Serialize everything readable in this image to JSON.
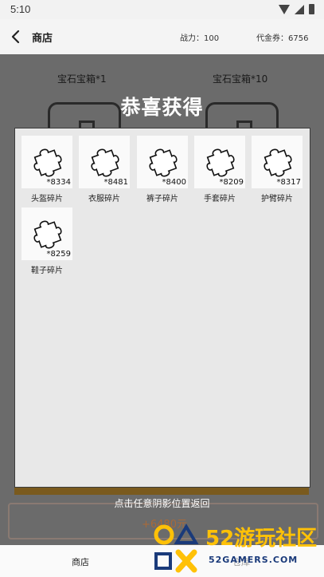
{
  "status_bar": {
    "time": "5:10",
    "icons": [
      "wifi-icon",
      "signal-icon",
      "battery-icon"
    ]
  },
  "header": {
    "back_icon": "chevron-left-icon",
    "title": "商店",
    "power_label": "战力：100",
    "coupon_label": "代金券：6756"
  },
  "shop_background": {
    "chest_labels": [
      "宝石宝箱*1",
      "宝石宝箱*10"
    ],
    "buy_button_text": "+6480元"
  },
  "reward_dialog": {
    "title": "恭喜获得",
    "items": [
      {
        "name": "头盔碎片",
        "count": "*8334",
        "icon": "puzzle-piece-icon"
      },
      {
        "name": "衣服碎片",
        "count": "*8481",
        "icon": "puzzle-piece-icon"
      },
      {
        "name": "裤子碎片",
        "count": "*8400",
        "icon": "puzzle-piece-icon"
      },
      {
        "name": "手套碎片",
        "count": "*8209",
        "icon": "puzzle-piece-icon"
      },
      {
        "name": "护臂碎片",
        "count": "*8317",
        "icon": "puzzle-piece-icon"
      },
      {
        "name": "鞋子碎片",
        "count": "*8259",
        "icon": "puzzle-piece-icon"
      }
    ],
    "hint": "点击任意阴影位置返回"
  },
  "bottom_nav": {
    "shop": "商店",
    "warehouse": "仓库"
  },
  "watermark": {
    "main": "52游玩社区",
    "sub": "52GAMERS.COM",
    "colors": {
      "main": "#ffc107",
      "sub": "#1a3a7a"
    }
  }
}
